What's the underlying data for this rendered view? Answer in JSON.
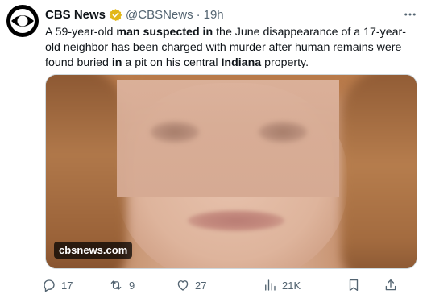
{
  "author": {
    "name": "CBS News",
    "handle": "@CBSNews",
    "separator": "·",
    "time": "19h"
  },
  "tweet": {
    "segments": [
      {
        "text": "A 59-year-old ",
        "bold": false
      },
      {
        "text": "man suspected in",
        "bold": true
      },
      {
        "text": " the June disappearance of a 17-year-old neighbor has been charged with murder after human remains were found buried ",
        "bold": false
      },
      {
        "text": "in",
        "bold": true
      },
      {
        "text": " a pit on his central ",
        "bold": false
      },
      {
        "text": "Indiana",
        "bold": true
      },
      {
        "text": " property.",
        "bold": false
      }
    ]
  },
  "media": {
    "watermark": "cbsnews.com"
  },
  "actions": {
    "reply_count": "17",
    "retweet_count": "9",
    "like_count": "27",
    "views_count": "21K"
  },
  "icons": {
    "avatar": "cbs-eye-logo-icon",
    "verified": "verified-badge-icon",
    "more": "more-dots-icon",
    "reply": "reply-icon",
    "retweet": "retweet-icon",
    "like": "heart-icon",
    "views": "views-chart-icon",
    "bookmark": "bookmark-icon",
    "share": "share-icon"
  },
  "colors": {
    "text": "#0f1419",
    "secondary": "#536471",
    "verified_gold": "#e2b719"
  }
}
